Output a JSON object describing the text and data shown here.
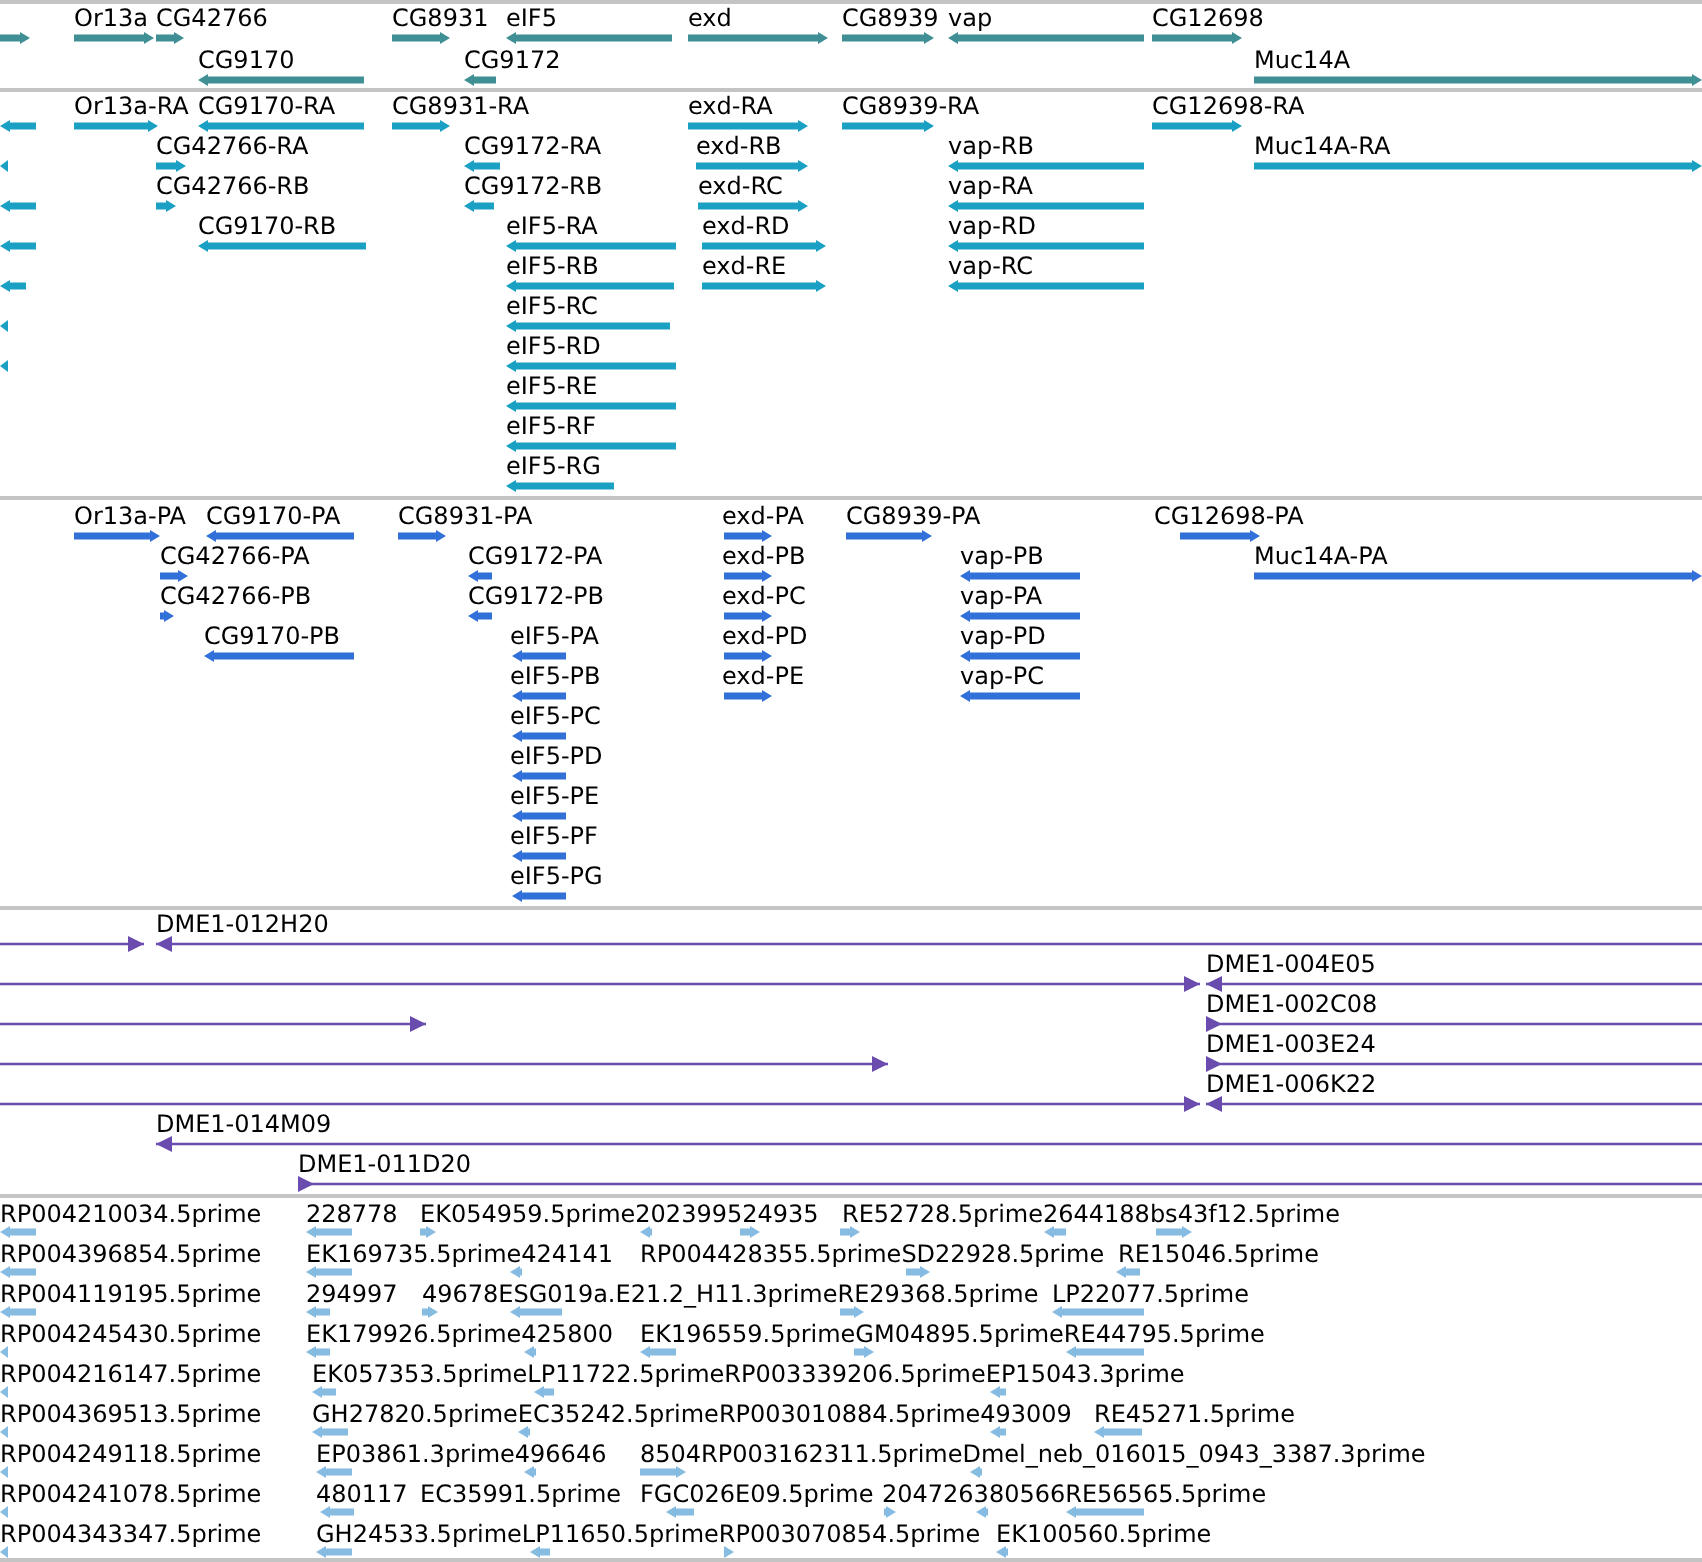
{
  "tracks": [
    {
      "kind": "gene",
      "features": [
        {
          "reverse": false
        },
        {
          "label": "Or13a",
          "reverse": false
        },
        {
          "label": "CG42766",
          "reverse": false
        },
        {
          "label": "CG8931",
          "reverse": false
        },
        {
          "label": "eIF5",
          "reverse": true
        },
        {
          "label": "exd",
          "reverse": false
        },
        {
          "label": "CG8939",
          "reverse": false
        },
        {
          "label": "vap",
          "reverse": true
        },
        {
          "label": "CG12698",
          "reverse": false
        },
        {
          "label": "CG9170",
          "reverse": true
        },
        {
          "label": "CG9172",
          "reverse": true
        },
        {
          "label": "Muc14A",
          "reverse": false
        }
      ]
    },
    {
      "kind": "transcript",
      "features": [
        {
          "reverse": true
        },
        {
          "label": "Or13a-RA",
          "reverse": false
        },
        {
          "label": "CG9170-RA",
          "reverse": true
        },
        {
          "label": "CG8931-RA",
          "reverse": false
        },
        {
          "label": "exd-RA",
          "reverse": false
        },
        {
          "label": "CG8939-RA",
          "reverse": false
        },
        {
          "label": "CG12698-RA",
          "reverse": false
        },
        {
          "reverse": true
        },
        {
          "label": "CG42766-RA",
          "reverse": false
        },
        {
          "label": "CG9172-RA",
          "reverse": true
        },
        {
          "label": "exd-RB",
          "reverse": false
        },
        {
          "label": "vap-RB",
          "reverse": true
        },
        {
          "label": "Muc14A-RA",
          "reverse": false
        },
        {
          "reverse": true
        },
        {
          "label": "CG42766-RB",
          "reverse": false
        },
        {
          "label": "CG9172-RB",
          "reverse": true
        },
        {
          "label": "exd-RC",
          "reverse": false
        },
        {
          "label": "vap-RA",
          "reverse": true
        },
        {
          "reverse": true
        },
        {
          "label": "CG9170-RB",
          "reverse": true
        },
        {
          "label": "eIF5-RA",
          "reverse": true
        },
        {
          "label": "exd-RD",
          "reverse": false
        },
        {
          "label": "vap-RD",
          "reverse": true
        },
        {
          "reverse": true
        },
        {
          "label": "eIF5-RB",
          "reverse": true
        },
        {
          "label": "exd-RE",
          "reverse": false
        },
        {
          "label": "vap-RC",
          "reverse": true
        },
        {
          "reverse": true
        },
        {
          "label": "eIF5-RC",
          "reverse": true
        },
        {
          "reverse": true
        },
        {
          "label": "eIF5-RD",
          "reverse": true
        },
        {
          "label": "eIF5-RE",
          "reverse": true
        },
        {
          "label": "eIF5-RF",
          "reverse": true
        },
        {
          "label": "eIF5-RG",
          "reverse": true
        }
      ]
    },
    {
      "kind": "protein",
      "features": [
        {
          "label": "Or13a-PA",
          "reverse": false
        },
        {
          "label": "CG9170-PA",
          "reverse": true
        },
        {
          "label": "CG8931-PA",
          "reverse": false
        },
        {
          "label": "exd-PA",
          "reverse": false
        },
        {
          "label": "CG8939-PA",
          "reverse": false
        },
        {
          "label": "CG12698-PA",
          "reverse": false
        },
        {
          "label": "CG42766-PA",
          "reverse": false
        },
        {
          "label": "CG9172-PA",
          "reverse": true
        },
        {
          "label": "exd-PB",
          "reverse": false
        },
        {
          "label": "vap-PB",
          "reverse": true
        },
        {
          "label": "Muc14A-PA",
          "reverse": false
        },
        {
          "label": "CG42766-PB",
          "reverse": false
        },
        {
          "label": "CG9172-PB",
          "reverse": true
        },
        {
          "label": "exd-PC",
          "reverse": false
        },
        {
          "label": "vap-PA",
          "reverse": true
        },
        {
          "label": "CG9170-PB",
          "reverse": true
        },
        {
          "label": "eIF5-PA",
          "reverse": true
        },
        {
          "label": "exd-PD",
          "reverse": false
        },
        {
          "label": "vap-PD",
          "reverse": true
        },
        {
          "label": "eIF5-PB",
          "reverse": true
        },
        {
          "label": "exd-PE",
          "reverse": false
        },
        {
          "label": "vap-PC",
          "reverse": true
        },
        {
          "label": "eIF5-PC",
          "reverse": true
        },
        {
          "label": "eIF5-PD",
          "reverse": true
        },
        {
          "label": "eIF5-PE",
          "reverse": true
        },
        {
          "label": "eIF5-PF",
          "reverse": true
        },
        {
          "label": "eIF5-PG",
          "reverse": true
        }
      ]
    },
    {
      "kind": "clone",
      "features": [
        {
          "reverse": false
        },
        {
          "label": "DME1-012H20",
          "reverse": true
        },
        {
          "reverse": false
        },
        {
          "label": "DME1-004E05",
          "reverse": true
        },
        {
          "reverse": false
        },
        {
          "label": "DME1-002C08",
          "reverse": false
        },
        {
          "reverse": false
        },
        {
          "label": "DME1-003E24",
          "reverse": false
        },
        {
          "reverse": false
        },
        {
          "label": "DME1-006K22",
          "reverse": true
        },
        {
          "label": "DME1-014M09",
          "reverse": true
        },
        {
          "label": "DME1-011D20",
          "reverse": false
        }
      ]
    },
    {
      "kind": "est",
      "rows": [
        {
          "labels": [
            "RP004210034.5prime",
            "228778",
            "EK054959.5prime202399524935",
            "RE52728.5prime2644188bs43f12.5prime"
          ],
          "marks": [
            {
              "reverse": true
            },
            {
              "reverse": true
            },
            {
              "reverse": false
            },
            {
              "reverse": true
            },
            {
              "reverse": false
            },
            {
              "reverse": false
            },
            {
              "reverse": true
            },
            {
              "reverse": false
            }
          ]
        },
        {
          "labels": [
            "RP004396854.5prime",
            "EK169735.5prime424141",
            "RP004428355.5primeSD22928.5prime",
            "RE15046.5prime"
          ],
          "marks": [
            {
              "reverse": true
            },
            {
              "reverse": true
            },
            {
              "reverse": true
            },
            {
              "reverse": false
            },
            {
              "reverse": true
            }
          ]
        },
        {
          "labels": [
            "RP004119195.5prime",
            "294997",
            "49678ESG019a.E21.2_H11.3primeRE29368.5prime",
            "LP22077.5prime"
          ],
          "marks": [
            {
              "reverse": true
            },
            {
              "reverse": true
            },
            {
              "reverse": false
            },
            {
              "reverse": true
            },
            {
              "reverse": false
            },
            {
              "reverse": true
            }
          ]
        },
        {
          "labels": [
            "RP004245430.5prime",
            "EK179926.5prime425800",
            "EK196559.5primeGM04895.5primeRE44795.5prime"
          ],
          "marks": [
            {
              "reverse": true
            },
            {
              "reverse": true
            },
            {
              "reverse": true
            },
            {
              "reverse": true
            },
            {
              "reverse": false
            },
            {
              "reverse": true
            }
          ]
        },
        {
          "labels": [
            "RP004216147.5prime",
            "EK057353.5primeLP11722.5primeRP003339206.5primeEP15043.3prime"
          ],
          "marks": [
            {
              "reverse": true
            },
            {
              "reverse": true
            },
            {
              "reverse": true
            },
            {
              "reverse": true
            }
          ]
        },
        {
          "labels": [
            "RP004369513.5prime",
            "GH27820.5primeEC35242.5primeRP003010884.5prime493009",
            "RE45271.5prime"
          ],
          "marks": [
            {
              "reverse": true
            },
            {
              "reverse": true
            },
            {
              "reverse": true
            },
            {
              "reverse": true
            },
            {
              "reverse": true
            }
          ]
        },
        {
          "labels": [
            "RP004249118.5prime",
            "EP03861.3prime496646",
            "8504RP003162311.5primeDmel_neb_016015_0943_3387.3prime"
          ],
          "marks": [
            {
              "reverse": true
            },
            {
              "reverse": true
            },
            {
              "reverse": true
            },
            {
              "reverse": false
            },
            {
              "reverse": true
            }
          ]
        },
        {
          "labels": [
            "RP004241078.5prime",
            "480117",
            "EC35991.5prime",
            "FGC026E09.5prime",
            "204726380566RE56565.5prime"
          ],
          "marks": [
            {
              "reverse": true
            },
            {
              "reverse": true
            },
            {
              "reverse": true
            },
            {
              "reverse": false
            },
            {
              "reverse": true
            },
            {
              "reverse": true
            }
          ]
        },
        {
          "labels": [
            "RP004343347.5prime",
            "GH24533.5primeLP11650.5primeRP003070854.5prime",
            "EK100560.5prime"
          ],
          "marks": [
            {
              "reverse": true
            },
            {
              "reverse": true
            },
            {
              "reverse": true
            },
            {
              "reverse": false
            },
            {
              "reverse": true
            }
          ]
        }
      ]
    }
  ]
}
